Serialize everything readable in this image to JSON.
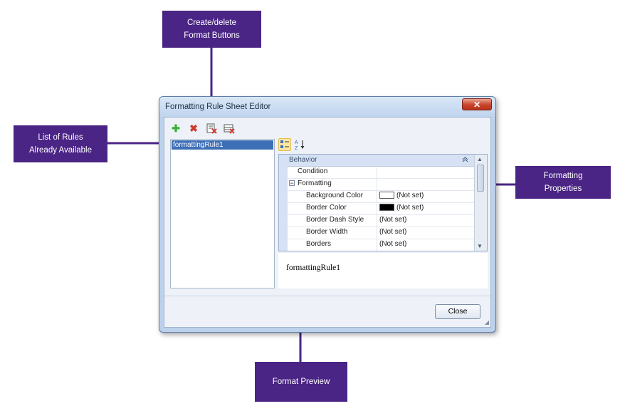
{
  "annotations": {
    "create_delete": [
      "Create/delete",
      "Format Buttons"
    ],
    "list_of_rules": [
      "List of Rules",
      "Already Available"
    ],
    "formatting_properties": [
      "Formatting",
      "Properties"
    ],
    "format_preview": [
      "Format Preview"
    ]
  },
  "colors": {
    "annotation_bg": "#4a2585",
    "selection": "#3d6fb6",
    "window_frame": "#bcd2ec"
  },
  "window": {
    "title": "Formatting Rule Sheet Editor",
    "close_glyph": "✕"
  },
  "toolbar": {
    "add_icon": "plus-icon",
    "delete_icon": "delete-icon",
    "add_glyph": "✚",
    "delete_glyph": "✖"
  },
  "rules": [
    "formattingRule1"
  ],
  "property_grid": {
    "category": "Behavior",
    "rows": [
      {
        "name": "Condition",
        "value": ""
      },
      {
        "name": "Formatting",
        "value": "",
        "expander": "−"
      },
      {
        "name": "Background Color",
        "value": "(Not set)",
        "swatch": "#ffffff"
      },
      {
        "name": "Border Color",
        "value": "(Not set)",
        "swatch": "#000000"
      },
      {
        "name": "Border Dash Style",
        "value": "(Not set)"
      },
      {
        "name": "Border Width",
        "value": "(Not set)"
      },
      {
        "name": "Borders",
        "value": "(Not set)"
      }
    ]
  },
  "preview": {
    "text": "formattingRule1"
  },
  "buttons": {
    "close": "Close"
  }
}
